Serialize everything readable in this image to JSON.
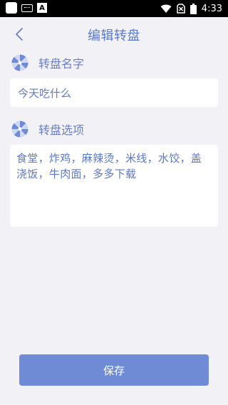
{
  "status_bar": {
    "time": "4:33",
    "icons": [
      "app-notification-icon",
      "keyboard-icon",
      "font-a-icon",
      "wifi-icon",
      "no-sim-icon",
      "battery-icon"
    ]
  },
  "header": {
    "title": "编辑转盘",
    "back_icon": "chevron-left-icon"
  },
  "name_section": {
    "label": "转盘名字",
    "icon": "wheel-icon",
    "value": "今天吃什么"
  },
  "options_section": {
    "label": "转盘选项",
    "icon": "wheel-icon",
    "value": "食堂，炸鸡，麻辣烫，米线，水饺，盖浇饭，牛肉面，多多下载"
  },
  "save_button": {
    "label": "保存"
  },
  "colors": {
    "accent": "#5c78c8",
    "button": "#6f8bd6",
    "background": "#f2f2f6",
    "card": "#ffffff",
    "status_bar": "#000000"
  }
}
